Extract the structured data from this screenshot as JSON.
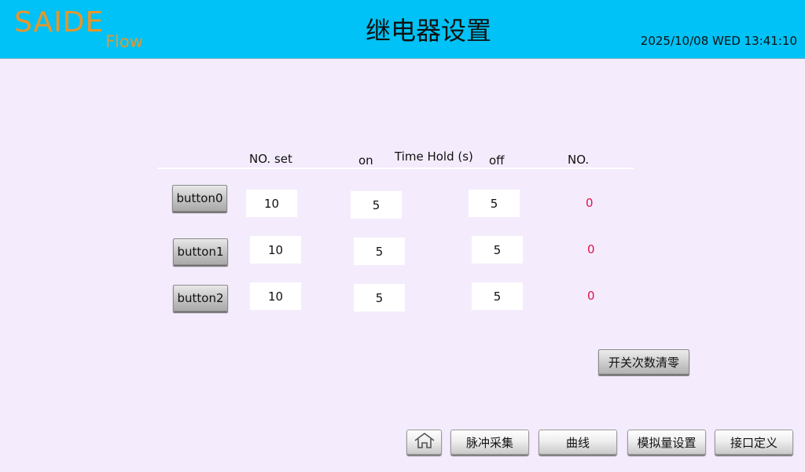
{
  "header": {
    "logo_main": "SAIDE",
    "logo_sub": "Flow",
    "title": "继电器设置",
    "datetime": "2025/10/08 WED 13:41:10"
  },
  "columns": {
    "no_set": "NO. set",
    "on": "on",
    "time_hold": "Time Hold (s)",
    "off": "off",
    "no": "NO."
  },
  "rows": [
    {
      "button": "button0",
      "no_set": "10",
      "on": "5",
      "off": "5",
      "count": "0"
    },
    {
      "button": "button1",
      "no_set": "10",
      "on": "5",
      "off": "5",
      "count": "0"
    },
    {
      "button": "button2",
      "no_set": "10",
      "on": "5",
      "off": "5",
      "count": "0"
    }
  ],
  "clear_button": "开关次数清零",
  "nav": {
    "home_icon": "home-icon",
    "pulse": "脉冲采集",
    "curve": "曲线",
    "analog": "模拟量设置",
    "interface": "接口定义"
  },
  "colors": {
    "header_bg": "#00c2f6",
    "page_bg": "#f4ecfc",
    "logo": "#e8962a",
    "count_text": "#e0124c"
  }
}
